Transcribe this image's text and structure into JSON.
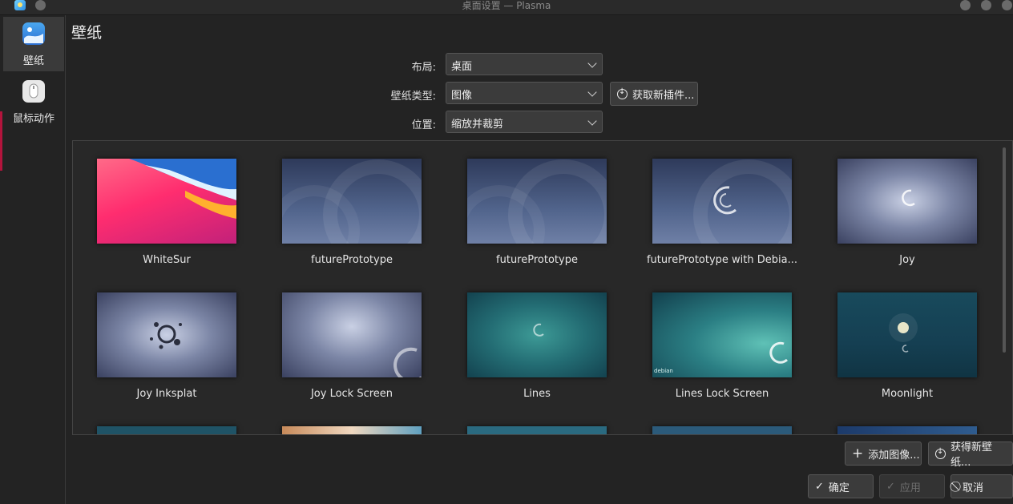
{
  "window": {
    "title": "桌面设置 — Plasma"
  },
  "sidebar": {
    "items": [
      {
        "label": "壁纸",
        "icon": "wallpaper-icon"
      },
      {
        "label": "鼠标动作",
        "icon": "mouse-icon"
      }
    ]
  },
  "page": {
    "title": "壁纸"
  },
  "form": {
    "layout_label": "布局:",
    "layout_value": "桌面",
    "type_label": "壁纸类型:",
    "type_value": "图像",
    "position_label": "位置:",
    "position_value": "缩放并裁剪",
    "get_plugins_label": "获取新插件..."
  },
  "wallpapers": [
    {
      "name": "WhiteSur"
    },
    {
      "name": "futurePrototype"
    },
    {
      "name": "futurePrototype"
    },
    {
      "name": "futurePrototype with Debia..."
    },
    {
      "name": "Joy"
    },
    {
      "name": "Joy Inksplat"
    },
    {
      "name": "Joy Lock Screen"
    },
    {
      "name": "Lines"
    },
    {
      "name": "Lines Lock Screen",
      "corner_text": "debian"
    },
    {
      "name": "Moonlight"
    }
  ],
  "actions": {
    "add_image": "添加图像...",
    "get_wallpapers": "获得新壁纸..."
  },
  "footer": {
    "ok": "确定",
    "apply": "应用",
    "cancel": "取消"
  },
  "colors": {
    "accent": "#b3143c",
    "background": "#232323"
  }
}
